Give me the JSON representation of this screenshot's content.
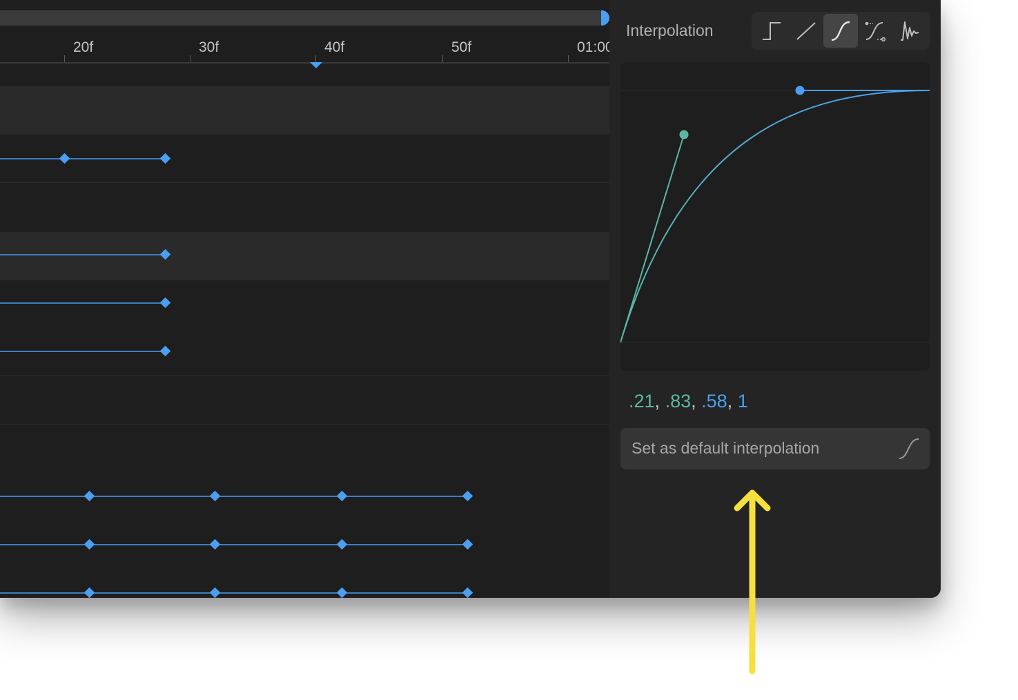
{
  "timeline": {
    "ruler_labels": [
      "20f",
      "30f",
      "40f",
      "50f",
      "01:00"
    ]
  },
  "interpolation": {
    "title": "Interpolation",
    "modes": [
      {
        "name": "hold",
        "icon": "step-interpolation-icon"
      },
      {
        "name": "linear",
        "icon": "linear-interpolation-icon"
      },
      {
        "name": "bezier",
        "icon": "bezier-interpolation-icon",
        "active": true
      },
      {
        "name": "custom",
        "icon": "custom-curve-interpolation-icon"
      },
      {
        "name": "spring",
        "icon": "spring-interpolation-icon"
      }
    ],
    "bezier": {
      "x1": ".21",
      "y1": ".83",
      "x2": ".58",
      "y2": "1"
    },
    "default_button_label": "Set as default interpolation"
  },
  "colors": {
    "accent_blue": "#4a9ff0",
    "accent_green": "#5ab7a3",
    "annotation_yellow": "#f6e03c"
  }
}
